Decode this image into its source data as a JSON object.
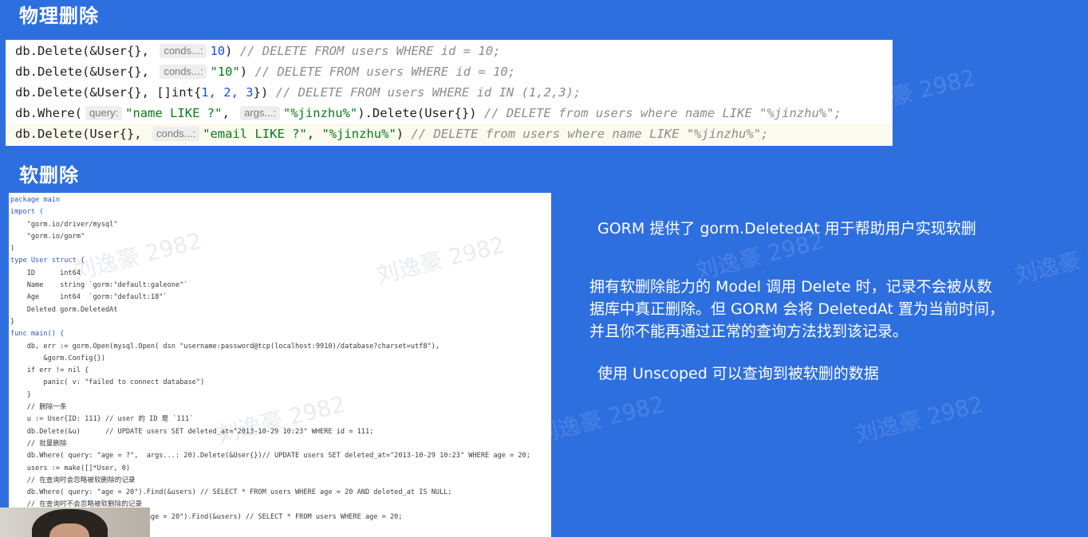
{
  "headings": {
    "physical_delete": "物理删除",
    "soft_delete": "软删除"
  },
  "code_lines": {
    "line1": {
      "a": "db.Delete(&User{}, ",
      "hint": "conds...:",
      "b": "10",
      "c": ") ",
      "comment": "// DELETE FROM users WHERE id = 10;"
    },
    "line2": {
      "a": "db.Delete(&User{}, ",
      "hint": "conds...:",
      "b": "\"10\"",
      "c": ") ",
      "comment": "// DELETE FROM users WHERE id = 10;"
    },
    "line3": {
      "a": "db.Delete(&User{}, []int{",
      "b": "1, 2, 3",
      "c": "}) ",
      "comment": "// DELETE FROM users WHERE id IN (1,2,3);"
    },
    "line4": {
      "a": "db.Where(",
      "hint1": "query:",
      "s1": "\"name LIKE ?\"",
      "mid": ", ",
      "hint2": "args...:",
      "s2": "\"%jinzhu%\"",
      "c": ").Delete(User{}) ",
      "comment": "// DELETE from users where name LIKE \"%jinzhu%\";"
    },
    "line5": {
      "a": "db.Delete(User{}, ",
      "hint": "conds...:",
      "s1": "\"email LIKE ?\"",
      "mid": ", ",
      "s2": "\"%jinzhu%\"",
      "c": ") ",
      "comment": "// DELETE from users where name LIKE \"%jinzhu%\";"
    }
  },
  "screenshot_code": [
    "package main",
    "import (",
    "    \"gorm.io/driver/mysql\"",
    "    \"gorm.io/gorm\"",
    ")",
    "type User struct {",
    "    ID      int64",
    "    Name    string `gorm:\"default:galeone\"`",
    "    Age     int64  `gorm:\"default:18\"`",
    "    Deleted gorm.DeletedAt",
    "}",
    "func main() {",
    "    db, err := gorm.Open(mysql.Open( dsn \"username:password@tcp(localhost:9910)/database?charset=utf8\"),",
    "        &gorm.Config{})",
    "    if err != nil {",
    "        panic( v: \"failed to connect database\")",
    "    }",
    "    // 删除一条",
    "    u := User{ID: 111} // user 的 ID 是 `111`",
    "    db.Delete(&u)      // UPDATE users SET deleted_at=\"2013-10-29 10:23\" WHERE id = 111;",
    "    // 批量删除",
    "    db.Where( query: \"age = ?\",  args...: 20).Delete(&User{})// UPDATE users SET deleted_at=\"2013-10-29 10:23\" WHERE age = 20;",
    "    users := make([]*User, 0)",
    "    // 在查询时会忽略被软删除的记录",
    "    db.Where( query: \"age = 20\").Find(&users) // SELECT * FROM users WHERE age = 20 AND deleted_at IS NULL;",
    "    // 在查询时不会忽略被软删除的记录",
    "    db.Unscoped().Where( query: \"age = 20\").Find(&users) // SELECT * FROM users WHERE age = 20;"
  ],
  "notes": {
    "n1": "GORM 提供了 gorm.DeletedAt 用于帮助用户实现软删",
    "n2_line1": "拥有软删除能力的 Model 调用 Delete 时，记录不会被从数",
    "n2_line2": "据库中真正删除。但 GORM 会将 DeletedAt 置为当前时间，",
    "n2_line3": "并且你不能再通过正常的查询方法找到该记录。",
    "n3": "使用 Unscoped 可以查询到被软删的数据"
  },
  "watermark": "刘逸豪 2982"
}
